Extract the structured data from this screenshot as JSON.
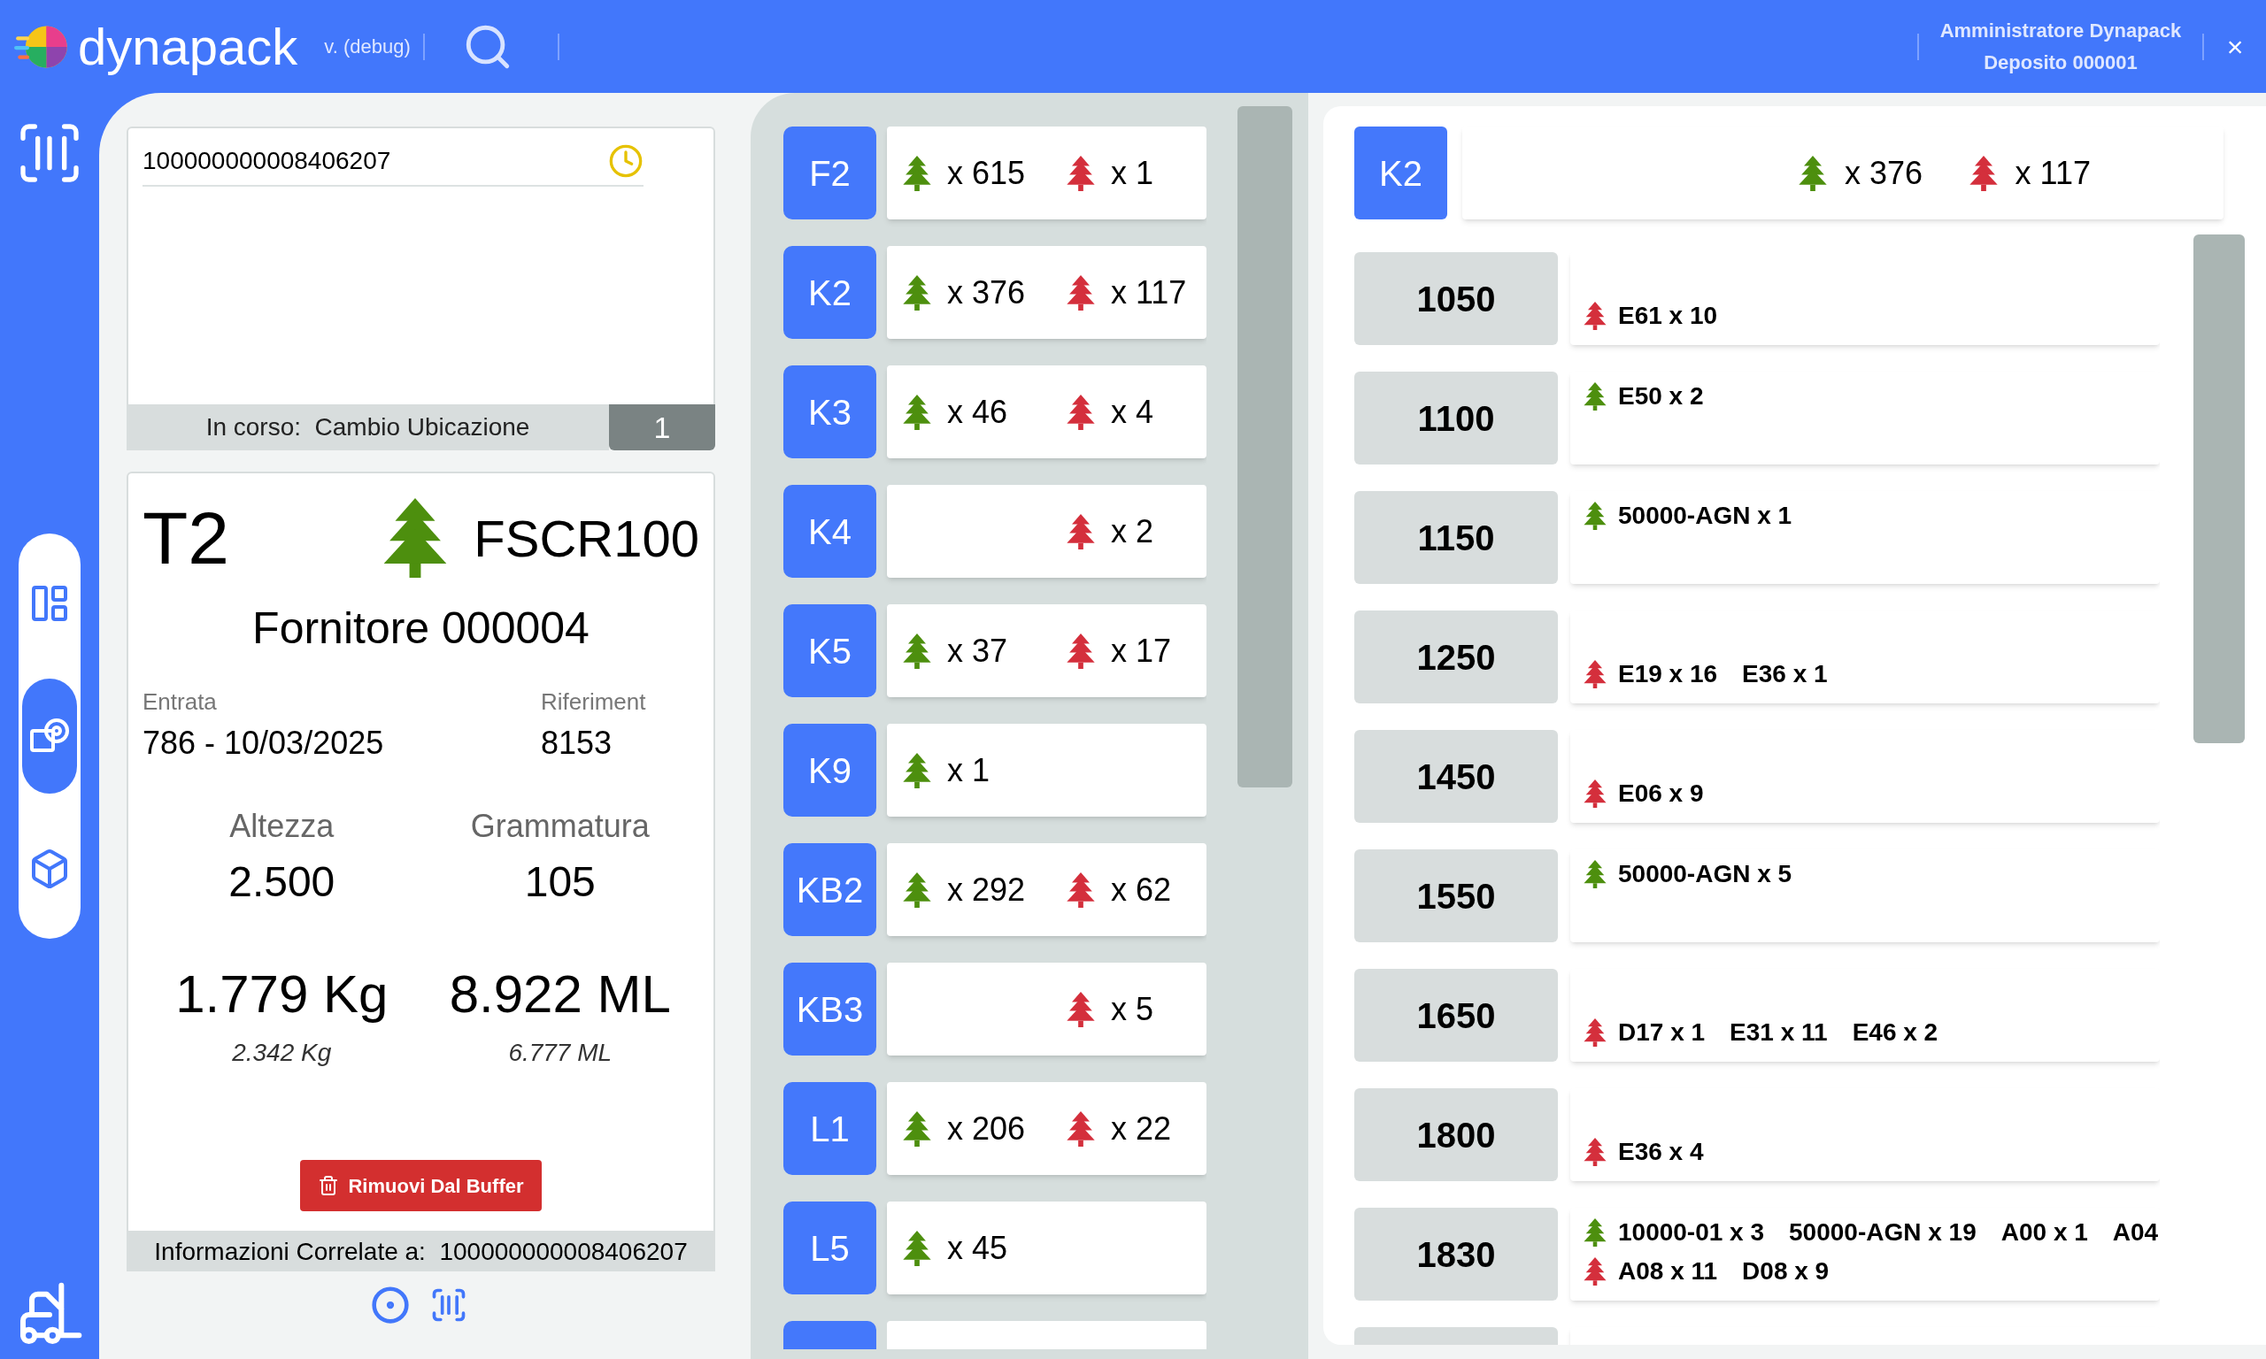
{
  "app": {
    "name": "dynapack",
    "version": "v. (debug)",
    "user": "Amministratore Dynapack",
    "depot": "Deposito 000001",
    "close": "×"
  },
  "sidebar": {
    "items": [
      {
        "kind": "floor-plan",
        "selected": false
      },
      {
        "kind": "roll",
        "selected": true
      },
      {
        "kind": "cube",
        "selected": false
      }
    ]
  },
  "scan": {
    "value": "100000000008406207",
    "status": "In corso:  Cambio Ubicazione",
    "count": "1"
  },
  "detail": {
    "type": "T2",
    "cert": "FSCR100",
    "supplier": "Fornitore 000004",
    "fields": [
      {
        "label": "Entrata",
        "value": "786 - 10/03/2025"
      },
      {
        "label": "Riferiment",
        "value": "8153"
      }
    ],
    "measures": [
      {
        "label": "Altezza",
        "value": "2.500"
      },
      {
        "label": "Grammatura",
        "value": "105"
      }
    ],
    "totals": [
      {
        "value": "1.779 Kg",
        "sub": "2.342 Kg"
      },
      {
        "value": "8.922 ML",
        "sub": "6.777 ML"
      }
    ],
    "button": "Rimuovi Dal Buffer",
    "related": "Informazioni Correlate a:  100000000008406207"
  },
  "locations": [
    {
      "code": "F2",
      "green": "x 615",
      "red": "x 1",
      "selected": false
    },
    {
      "code": "K2",
      "green": "x 376",
      "red": "x 117",
      "selected": false
    },
    {
      "code": "K3",
      "green": "x 46",
      "red": "x 4",
      "selected": false
    },
    {
      "code": "K4",
      "red": "x 2",
      "selected": false
    },
    {
      "code": "K5",
      "green": "x 37",
      "red": "x 17",
      "selected": false
    },
    {
      "code": "K9",
      "green": "x 1",
      "selected": false
    },
    {
      "code": "KB2",
      "green": "x 292",
      "red": "x 62",
      "selected": false
    },
    {
      "code": "KB3",
      "red": "x 5",
      "selected": false
    },
    {
      "code": "L1",
      "green": "x 206",
      "red": "x 22",
      "selected": false
    },
    {
      "code": "L5",
      "green": "x 45",
      "selected": false
    }
  ],
  "selected_location": {
    "code": "K2",
    "green": "x 376",
    "red": "x 117"
  },
  "positions": [
    {
      "number": "1050",
      "red": [
        "E61 x 10"
      ]
    },
    {
      "number": "1100",
      "green": [
        "E50 x 2"
      ]
    },
    {
      "number": "1150",
      "green": [
        "50000-AGN x 1"
      ]
    },
    {
      "number": "1250",
      "red": [
        "E19 x 16",
        "E36 x 1"
      ]
    },
    {
      "number": "1450",
      "red": [
        "E06 x 9"
      ]
    },
    {
      "number": "1550",
      "green": [
        "50000-AGN x 5"
      ]
    },
    {
      "number": "1650",
      "red": [
        "D17 x 1",
        "E31 x 11",
        "E46 x 2"
      ]
    },
    {
      "number": "1800",
      "red": [
        "E36 x 4"
      ]
    },
    {
      "number": "1830",
      "green": [
        "10000-01 x 3",
        "50000-AGN x 19",
        "A00 x 1",
        "A04"
      ],
      "red": [
        "A08 x 11",
        "D08 x 9"
      ]
    }
  ]
}
